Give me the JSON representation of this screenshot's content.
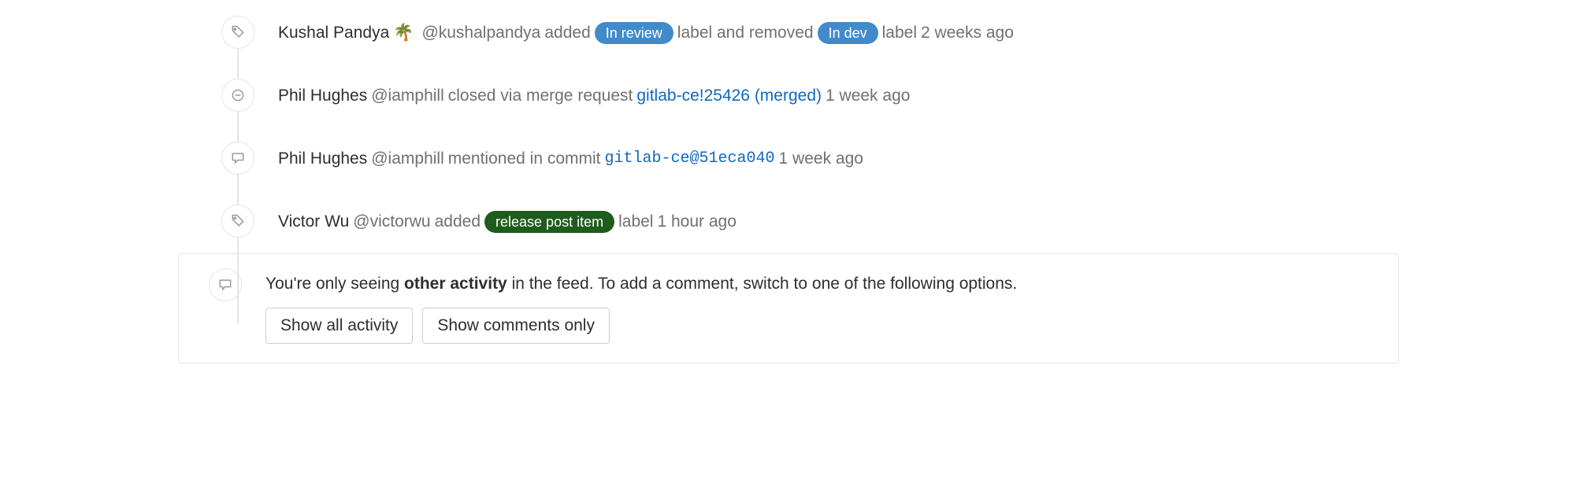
{
  "events": [
    {
      "author": "Kushal Pandya",
      "emoji": "🌴",
      "username": "@kushalpandya",
      "added_word": "added",
      "added_label": "In review",
      "mid_text": "label and removed",
      "removed_label": "In dev",
      "post_text": "label",
      "timestamp": "2 weeks ago"
    },
    {
      "author": "Phil Hughes",
      "username": "@iamphill",
      "pre_link": "closed via merge request",
      "link": "gitlab-ce!25426 (merged)",
      "timestamp": "1 week ago"
    },
    {
      "author": "Phil Hughes",
      "username": "@iamphill",
      "pre_link": "mentioned in commit",
      "mono_link": "gitlab-ce@51eca040",
      "timestamp": "1 week ago"
    },
    {
      "author": "Victor Wu",
      "username": "@victorwu",
      "added_word": "added",
      "added_label": "release post item",
      "post_text": "label",
      "timestamp": "1 hour ago"
    }
  ],
  "notice": {
    "pre": "You're only seeing ",
    "bold": "other activity",
    "post": " in the feed. To add a comment, switch to one of the following options.",
    "btn1": "Show all activity",
    "btn2": "Show comments only"
  }
}
